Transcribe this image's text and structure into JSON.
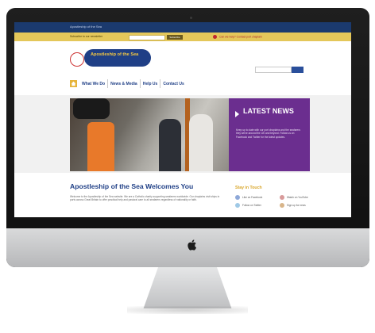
{
  "site": {
    "topbar_text": "Apostleship of the Sea",
    "notice_left": "Subscribe to our newsletter",
    "notice_button": "Subscribe",
    "notice_right": "Can we help? Contact port chaplain",
    "logo_text": "Apostleship of the Sea",
    "nav": [
      "What We Do",
      "News & Media",
      "Help Us",
      "Contact Us"
    ],
    "news": {
      "title": "LATEST NEWS",
      "body": "Keep up to date with our port chaplains and the seafarers they serve around the UK and beyond. Follow us on Facebook and Twitter for the latest updates."
    },
    "welcome": {
      "title": "Apostleship of the Sea Welcomes You",
      "body": "Welcome to the Apostleship of the Sea website. We are a Catholic charity supporting seafarers worldwide. Our chaplains visit ships in ports across Great Britain to offer practical help and pastoral care to all seafarers regardless of nationality or faith."
    },
    "stay_in_touch": "Stay in Touch",
    "social": [
      "Like on Facebook",
      "Follow on Twitter",
      "Watch on YouTube",
      "Sign up for news"
    ]
  },
  "colors": {
    "topbar": "#1b3a6e",
    "notice": "#e4c75a",
    "brand_blue": "#1f3f86",
    "news_purple": "#6b2e8f",
    "gold": "#d9a62a"
  }
}
